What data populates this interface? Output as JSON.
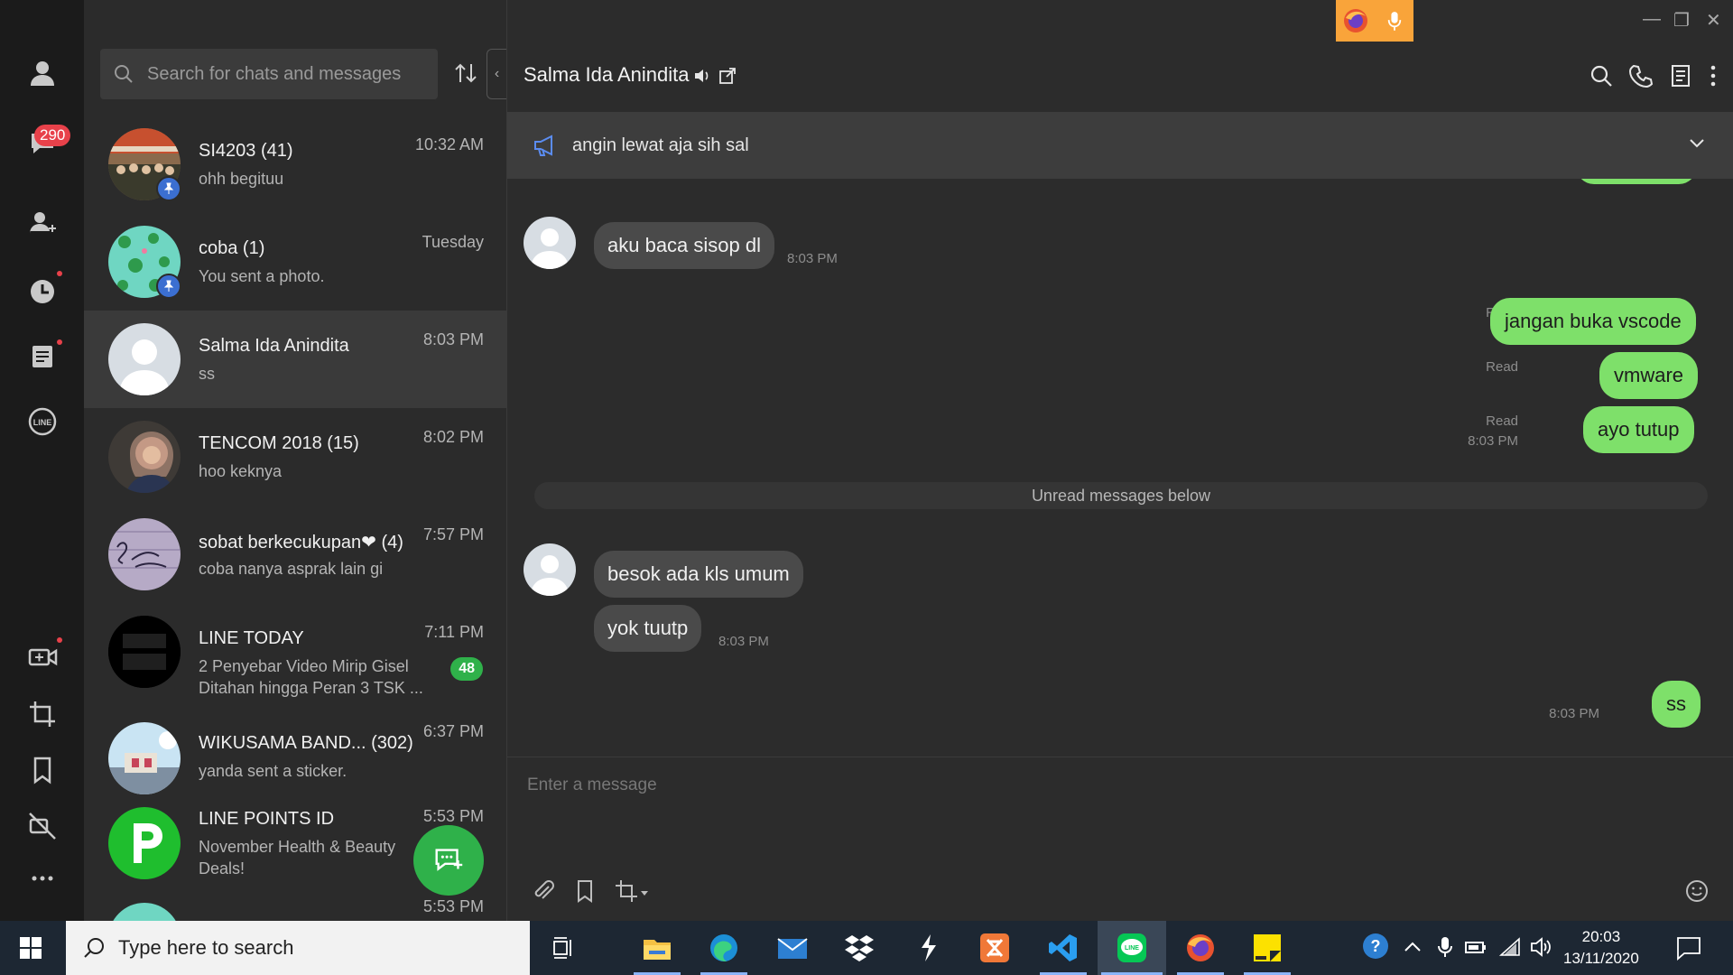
{
  "rail": {
    "unread_badge": "290"
  },
  "list": {
    "search_placeholder": "Search for chats and messages",
    "chats": [
      {
        "name": "SI4203  (41)",
        "preview": "ohh begituu",
        "time": "10:32 AM"
      },
      {
        "name": "coba  (1)",
        "preview": "You sent a photo.",
        "time": "Tuesday"
      },
      {
        "name": "Salma Ida Anindita",
        "preview": "ss",
        "time": "8:03 PM"
      },
      {
        "name": "TENCOM 2018  (15)",
        "preview": "hoo keknya",
        "time": "8:02 PM"
      },
      {
        "name": "sobat berkecukupan❤  (4)",
        "preview": "coba nanya asprak lain gi",
        "time": "7:57 PM"
      },
      {
        "name": "LINE TODAY",
        "preview": "2 Penyebar Video Mirip Gisel Ditahan hingga Peran 3 TSK ...",
        "time": "7:11 PM",
        "unread": "48"
      },
      {
        "name": "WIKUSAMA BAND...  (302)",
        "preview": "yanda sent a sticker.",
        "time": "6:37 PM"
      },
      {
        "name": "LINE POINTS ID",
        "preview": "November Health & Beauty Deals!",
        "time": "5:53 PM"
      },
      {
        "name": "",
        "preview": "",
        "time": "5:53 PM"
      }
    ]
  },
  "conversation": {
    "title": "Salma Ida Anindita",
    "announcement": "angin lewat aja sih sal",
    "messages": {
      "m1": {
        "text": "aku baca sisop dl",
        "time": "8:03 PM"
      },
      "m2": {
        "text": "jangan buka vscode",
        "status": "Read"
      },
      "m3": {
        "text": "vmware",
        "status": "Read"
      },
      "m4": {
        "text": "ayo tutup",
        "status": "Read",
        "time": "8:03 PM"
      },
      "divider": "Unread messages below",
      "m5": {
        "text": "besok ada kls umum"
      },
      "m6": {
        "text": "yok tuutp",
        "time": "8:03 PM"
      },
      "m7": {
        "text": "ss",
        "time": "8:03 PM"
      }
    },
    "composer_placeholder": "Enter a message"
  },
  "taskbar": {
    "search_placeholder": "Type here to search",
    "time": "20:03",
    "date": "13/11/2020"
  },
  "colors": {
    "accent_green": "#2fb14a",
    "bubble_out": "#7ee06a",
    "bubble_in": "#4a4a4a",
    "badge_red": "#e8414a"
  }
}
